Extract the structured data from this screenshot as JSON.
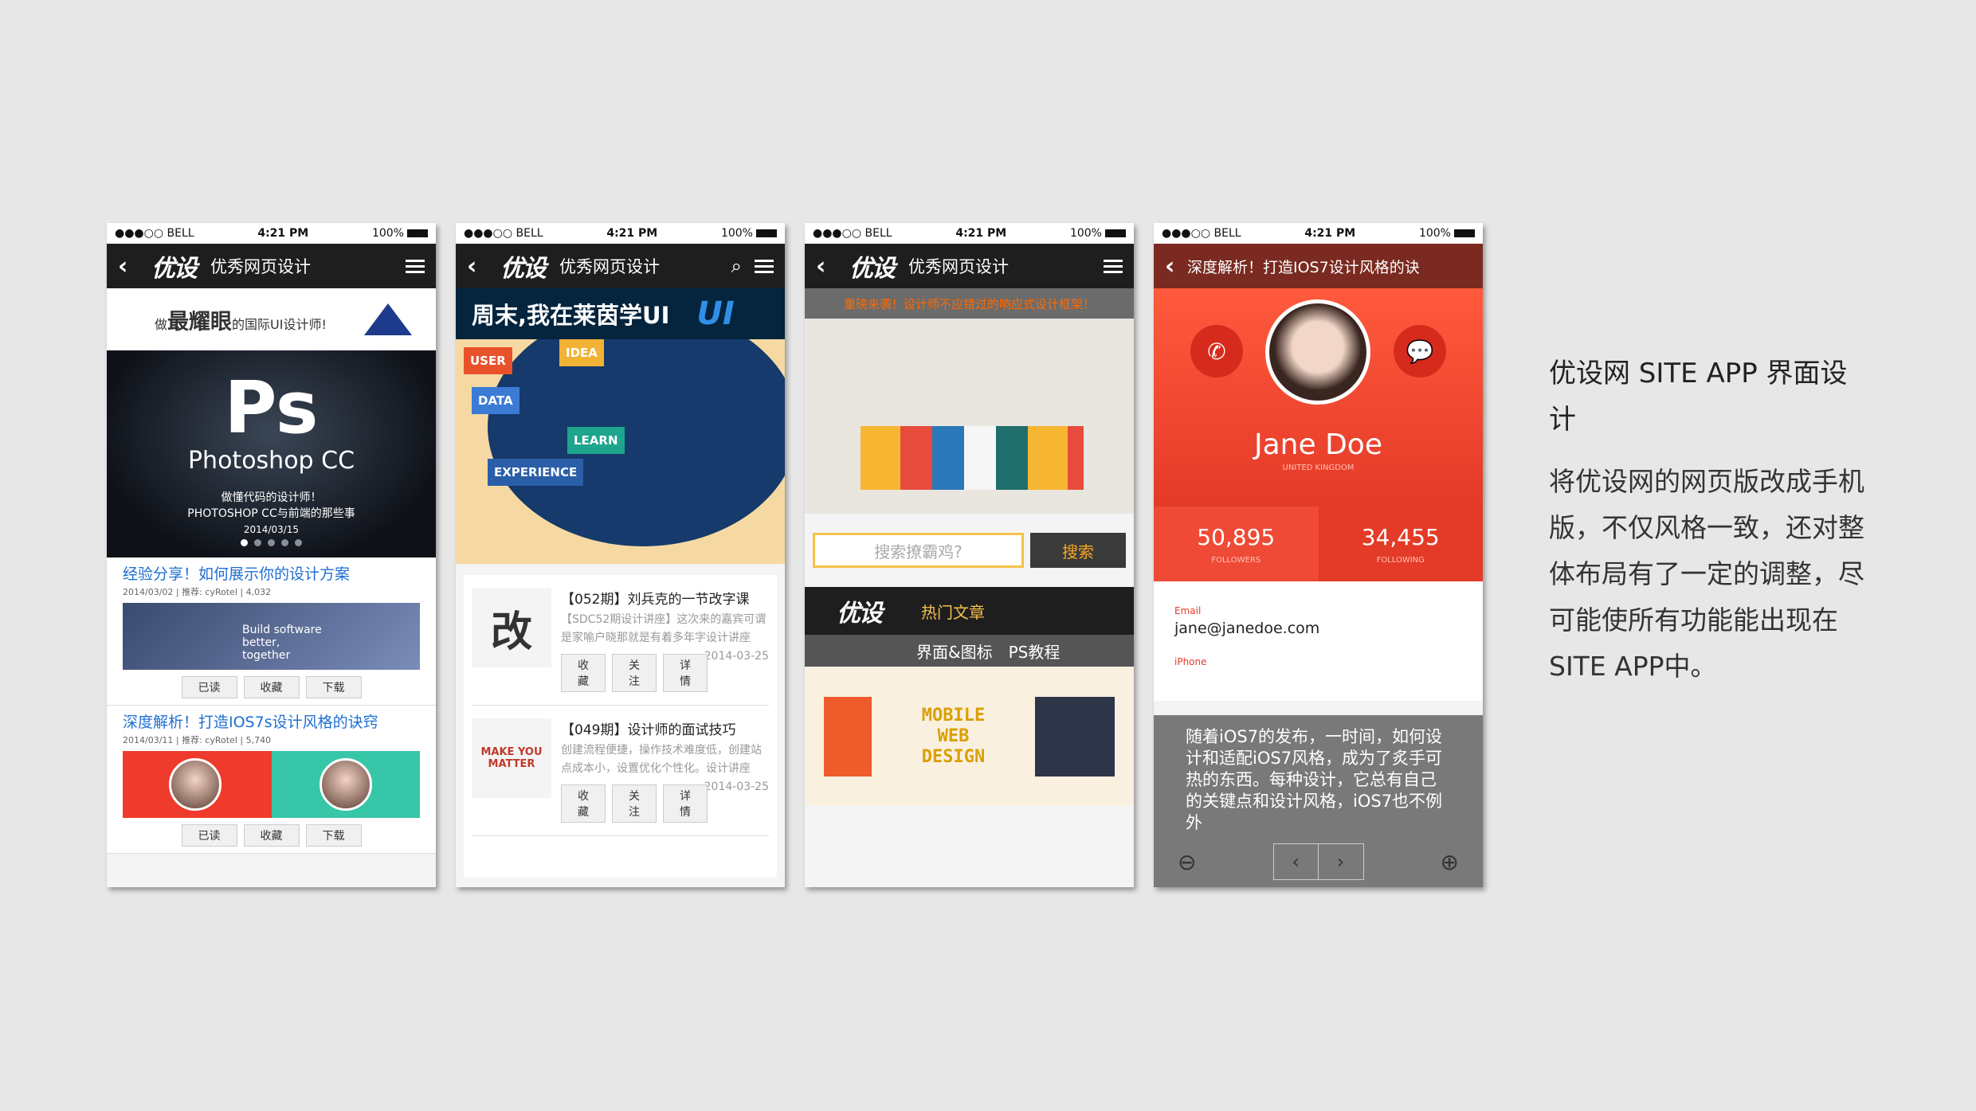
{
  "status": {
    "carrier": "●●●○○ BELL",
    "time": "4:21 PM",
    "battery": "100%"
  },
  "phone1": {
    "nav_title": "优秀网页设计",
    "ad_pre": "做",
    "ad_big": "最耀眼",
    "ad_post": "的国际UI设计师!",
    "banner_logo": "Ps",
    "banner_name": "Photoshop CC",
    "banner_sub1": "做懂代码的设计师！",
    "banner_sub2": "PHOTOSHOP CC与前端的那些事",
    "banner_date": "2014/03/15",
    "articles": [
      {
        "title": "经验分享！如何展示你的设计方案",
        "meta": "2014/03/02 | 推荐: cyRotel | 4,032"
      },
      {
        "title": "深度解析！打造IOS7s设计风格的诀窍",
        "meta": "2014/03/11 | 推荐: cyRotel | 5,740"
      }
    ],
    "btn_read": "已读",
    "btn_fav": "收藏",
    "btn_dl": "下载",
    "img_text": "Build software better, together"
  },
  "phone2": {
    "nav_title": "优秀网页设计",
    "header": "周末,我在莱茵学UI",
    "header_ui": "UI",
    "puzzle": [
      "USER",
      "IDEA",
      "DATA",
      "LEARN",
      "EXPERIENCE"
    ],
    "items": [
      {
        "thumb": "改",
        "title": "【052期】刘兵克的一节改字课",
        "desc": "【SDC52期设计讲座】这次来的嘉宾可谓是家喻户晓那就是有着多年字设计讲座",
        "date": "2014-03-25"
      },
      {
        "thumb": "MAKE YOU MATTER",
        "title": "【049期】设计师的面试技巧",
        "desc": "创建流程便捷，操作技术难度低，创建站点成本小，设置优化个性化。设计讲座",
        "date": "2014-03-25"
      }
    ],
    "btn_fav": "收藏",
    "btn_follow": "关注",
    "btn_detail": "详情"
  },
  "phone3": {
    "nav_title": "优秀网页设计",
    "bar": "重磅来袭！设计师不应错过的响应式设计框架！",
    "search_placeholder": "搜索撩霸鸡?",
    "search_btn": "搜索",
    "hot": "热门文章",
    "tabs": [
      "界面&图标",
      "PS教程"
    ],
    "card_text": "MOBILE WEB DESIGN"
  },
  "phone4": {
    "nav_title": "深度解析！打造IOS7设计风格的诀",
    "name": "Jane Doe",
    "location": "UNITED KINGDOM",
    "followers": "50,895",
    "followers_label": "FOLLOWERS",
    "following": "34,455",
    "following_label": "FOLLOWING",
    "email_label": "Email",
    "email": "jane@janedoe.com",
    "phone_label": "iPhone",
    "overlay": "随着iOS7的发布，一时间，如何设计和适配iOS7风格，成为了炙手可热的东西。每种设计，它总有自己的关键点和设计风格，iOS7也不例外"
  },
  "side": {
    "title": "优设网 SITE APP 界面设计",
    "body": "将优设网的网页版改成手机版，不仅风格一致，还对整体布局有了一定的调整，尽可能使所有功能能出现在SITE APP中。"
  },
  "colors": {
    "accent_blue": "#1f6fd1",
    "accent_red": "#e43a28",
    "accent_orange": "#f6a623"
  }
}
